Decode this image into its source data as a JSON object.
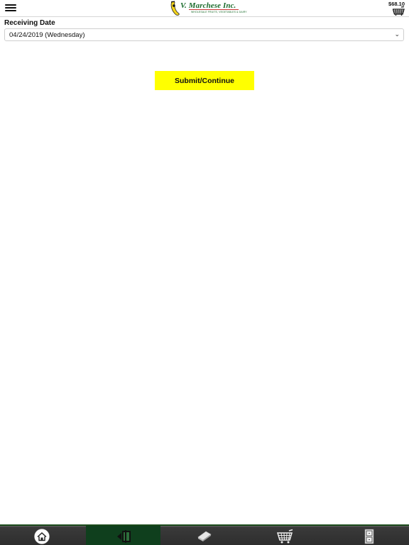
{
  "header": {
    "menu_icon": "hamburger-icon",
    "logo": {
      "name": "V. Marchese Inc.",
      "tagline": "WHOLESALE FRUITS, VEGETABLES & DAIRY"
    },
    "cart_total": "$68.10",
    "cart_icon": "shopping-basket-icon"
  },
  "form": {
    "receiving_date_label": "Receiving Date",
    "receiving_date_value": "04/24/2019 (Wednesday)",
    "submit_label": "Submit/Continue"
  },
  "bottom_nav": {
    "items": [
      {
        "name": "home",
        "icon": "home-icon",
        "active": false
      },
      {
        "name": "order",
        "icon": "order-door-icon",
        "active": true
      },
      {
        "name": "catalog",
        "icon": "book-icon",
        "active": false
      },
      {
        "name": "cart",
        "icon": "cart-icon",
        "active": false
      },
      {
        "name": "more",
        "icon": "cabinet-icon",
        "active": false
      }
    ]
  },
  "colors": {
    "brand_green": "#1a6b2b",
    "submit_yellow": "#ffff00",
    "nav_active_green": "#0f3f1d",
    "nav_background": "#2d2d2d"
  }
}
